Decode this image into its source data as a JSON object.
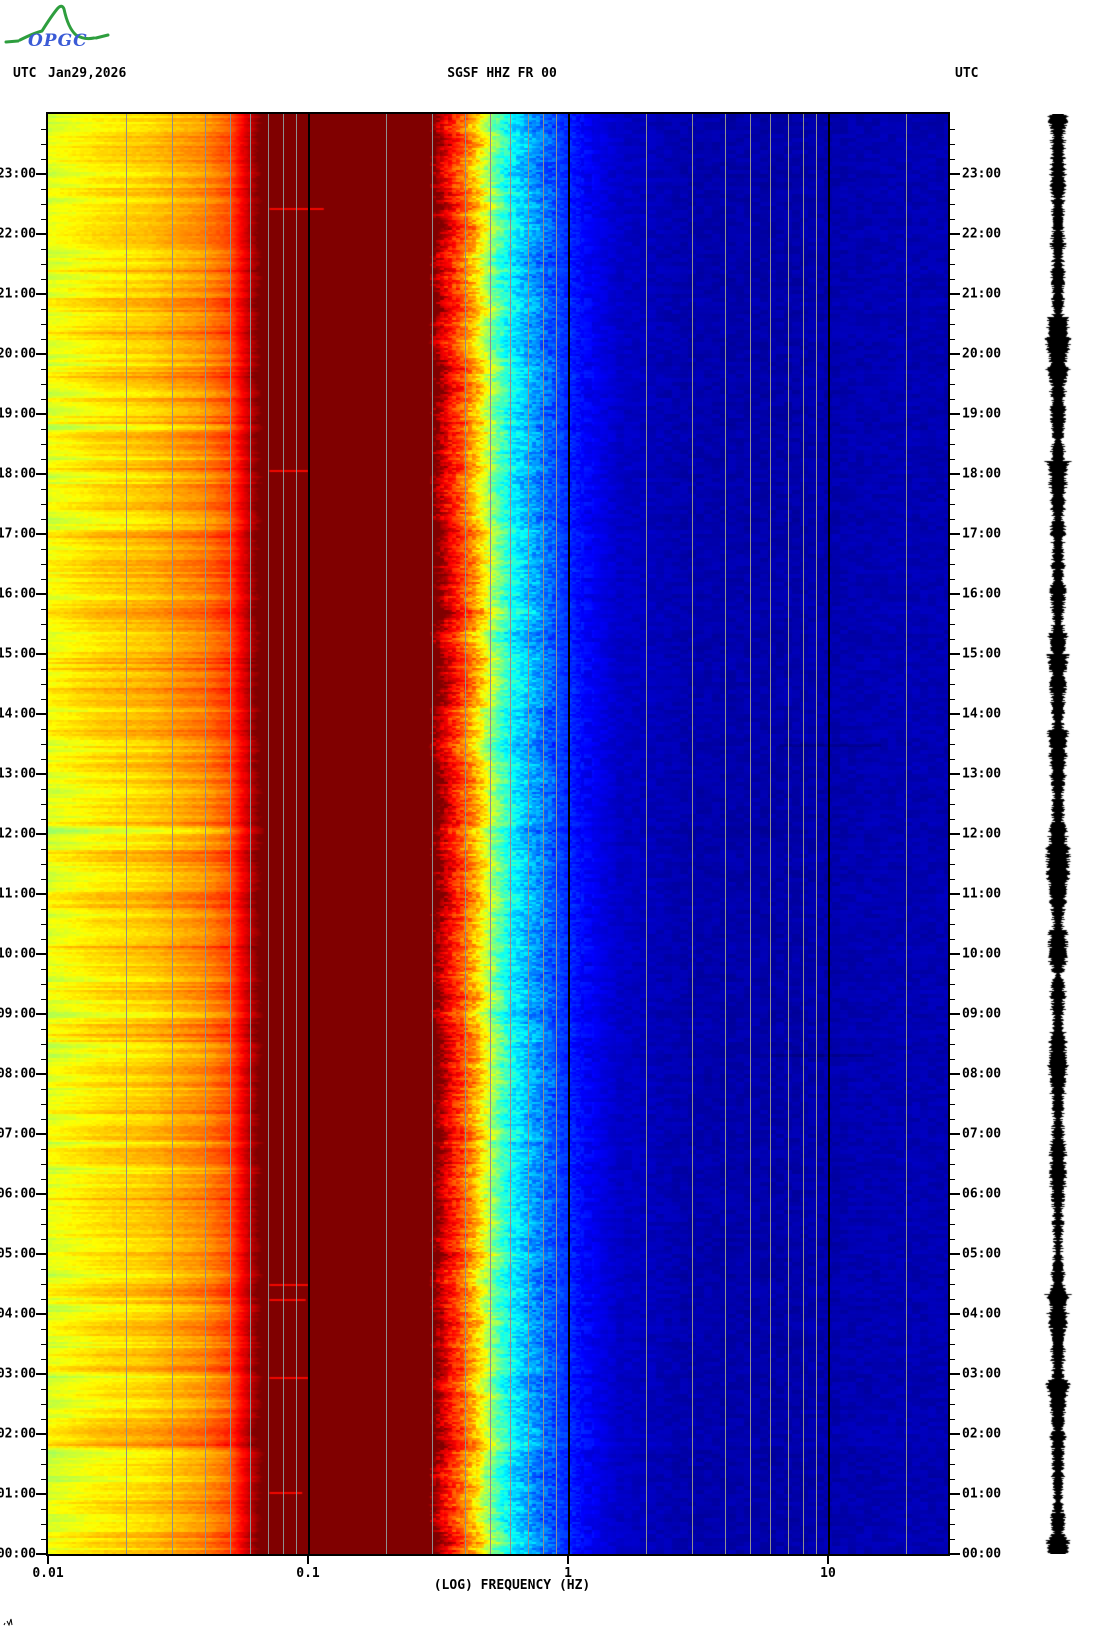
{
  "header": {
    "logo": "OPGC",
    "left_utc": "UTC",
    "date": "Jan29,2026",
    "title": "SGSF HHZ FR 00",
    "right_utc": "UTC"
  },
  "colors": {
    "background": "#ffffff",
    "axis": "#000000",
    "grid_minor": "#8f8f8f",
    "grid_decade": "#000000",
    "maroon_band": "#8b0000",
    "navy_background": "#0000a0",
    "event_line": "#f20800",
    "trace": "#000000",
    "logo_green": "#2e9e3e",
    "logo_blue": "#3b5bd6"
  },
  "chart_data": {
    "type": "heatmap",
    "title": "SGSF HHZ FR 00",
    "colormap": "jet",
    "x_axis": {
      "label": "(LOG) FREQUENCY (HZ)",
      "scale": "log",
      "range_hz": [
        0.01,
        28.9
      ],
      "tick_values": [
        0.01,
        0.1,
        1,
        10
      ],
      "tick_labels": [
        "0.01",
        "0.1",
        "1",
        "10"
      ],
      "minor_gridlines": "2-9 each decade, gray; decade lines black"
    },
    "y_axis": {
      "label": "UTC",
      "range_hours": [
        0,
        24
      ],
      "direction": "time increases upward, 00:00 at bottom",
      "major_tick_hours": 1,
      "minor_tick_minutes": 15,
      "hour_labels": [
        "23:00",
        "22:00",
        "21:00",
        "20:00",
        "19:00",
        "18:00",
        "17:00",
        "16:00",
        "15:00",
        "14:00",
        "13:00",
        "12:00",
        "11:00",
        "10:00",
        "09:00",
        "08:00",
        "07:00",
        "06:00",
        "05:00",
        "04:00",
        "03:00",
        "02:00",
        "01:00",
        "00:00"
      ]
    },
    "spectral_level_curve": [
      [
        -2.0,
        0.6
      ],
      [
        -1.8,
        0.65
      ],
      [
        -1.6,
        0.68
      ],
      [
        -1.4,
        0.74
      ],
      [
        -1.3,
        0.8
      ],
      [
        -1.16,
        1.05
      ],
      [
        -0.53,
        1.05
      ],
      [
        -0.46,
        0.88
      ],
      [
        -0.4,
        0.78
      ],
      [
        -0.35,
        0.68
      ],
      [
        -0.3,
        0.55
      ],
      [
        -0.26,
        0.45
      ],
      [
        -0.22,
        0.38
      ],
      [
        -0.15,
        0.3
      ],
      [
        -0.05,
        0.2
      ],
      [
        0.05,
        0.13
      ],
      [
        0.2,
        0.07
      ],
      [
        0.45,
        0.045
      ],
      [
        0.8,
        0.04
      ],
      [
        1.2,
        0.05
      ],
      [
        1.47,
        0.05
      ]
    ],
    "stripe_amplitude_segments": [
      [
        -2.0,
        -1.3,
        0.09
      ],
      [
        -1.3,
        -1.16,
        0.05
      ],
      [
        -1.16,
        -0.53,
        0.004
      ],
      [
        -0.53,
        -0.1,
        0.05
      ],
      [
        -0.1,
        0.1,
        0.02
      ],
      [
        0.1,
        1.47,
        0.008
      ]
    ],
    "texture_noise_segments": [
      [
        -2.0,
        -0.53,
        0.012
      ],
      [
        -0.53,
        -0.05,
        0.05
      ],
      [
        -0.05,
        0.1,
        0.025
      ],
      [
        0.1,
        1.47,
        0.015
      ]
    ],
    "bands_description": [
      {
        "freq_hz": [
          0.01,
          0.02
        ],
        "appearance": "green/cyan/yellow horizontal stripes"
      },
      {
        "freq_hz": [
          0.02,
          0.045
        ],
        "appearance": "yellow/orange stripes"
      },
      {
        "freq_hz": [
          0.045,
          0.07
        ],
        "appearance": "orange/red/dark-red stripes"
      },
      {
        "freq_hz": [
          0.07,
          0.3
        ],
        "appearance": "saturated dark-red (maroon) microseism band"
      },
      {
        "freq_hz": [
          0.3,
          0.5
        ],
        "appearance": "jagged red-orange-yellow-green transition"
      },
      {
        "freq_hz": [
          0.5,
          0.9
        ],
        "appearance": "cyan to light-blue speckle"
      },
      {
        "freq_hz": [
          0.9,
          28.9
        ],
        "appearance": "dark navy blue with faint mottling"
      }
    ],
    "event_red_lines": [
      {
        "time_utc": "22:26",
        "freq_hz": [
          0.071,
          0.115
        ]
      },
      {
        "time_utc": "18:04",
        "freq_hz": [
          0.071,
          0.1
        ]
      },
      {
        "time_utc": "04:30",
        "freq_hz": [
          0.071,
          0.1
        ]
      },
      {
        "time_utc": "04:15",
        "freq_hz": [
          0.071,
          0.098
        ]
      },
      {
        "time_utc": "02:57",
        "freq_hz": [
          0.071,
          0.1
        ]
      },
      {
        "time_utc": "01:02",
        "freq_hz": [
          0.071,
          0.095
        ]
      }
    ],
    "dark_streaks": [
      {
        "time_utc": "13:30",
        "freq_hz": [
          6.5,
          16
        ]
      },
      {
        "time_utc": "08:20",
        "freq_hz": [
          6.0,
          15
        ]
      }
    ],
    "helicorder_trace": {
      "position": "right of spectrogram",
      "color": "#000000",
      "description": "full-height vertical seismogram wiggle, amplitude 3-15 px"
    }
  }
}
